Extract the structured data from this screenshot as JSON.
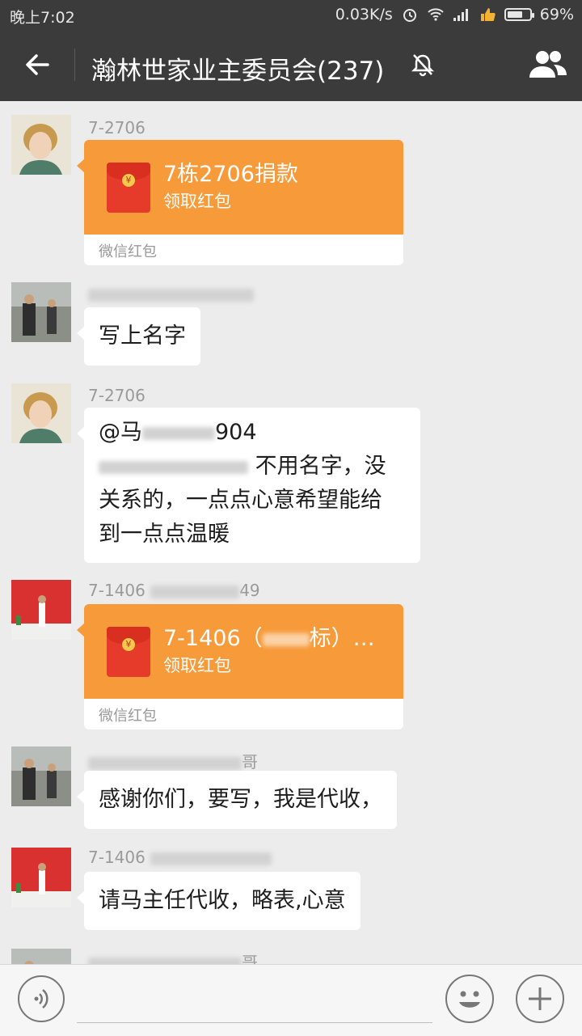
{
  "status_bar": {
    "time": "晚上7:02",
    "net_speed": "0.03K/s",
    "battery": "69%",
    "battery_level": 0.69
  },
  "header": {
    "title": "瀚林世家业主委员会(237)"
  },
  "messages": [
    {
      "sender": "7-2706",
      "type": "red_packet",
      "title": "7栋2706捐款",
      "action": "领取红包",
      "footer": "微信红包"
    },
    {
      "sender": "",
      "type": "text",
      "text": "写上名字"
    },
    {
      "sender": "7-2706",
      "type": "text",
      "mention": "@马",
      "mention_tail": "904",
      "line1_tail": "不用名字，没",
      "line2": "关系的，一点点心意希望能给",
      "line3": "到一点点温暖"
    },
    {
      "sender": "7-1406",
      "sender_tail": "49",
      "type": "red_packet",
      "title_prefix": "7-1406（",
      "title_suffix": "标）…",
      "action": "领取红包",
      "footer": "微信红包"
    },
    {
      "sender": "",
      "sender_tail": "哥",
      "type": "text",
      "text": "感谢你们，要写，我是代收，"
    },
    {
      "sender": "7-1406",
      "type": "text",
      "text": "请马主任代收，略表,心意"
    },
    {
      "sender": "",
      "sender_tail": "哥",
      "type": "text",
      "text": ""
    }
  ],
  "colors": {
    "header_bg": "#3b3b3b",
    "chat_bg": "#ececec",
    "red_packet": "#f79a3a"
  }
}
